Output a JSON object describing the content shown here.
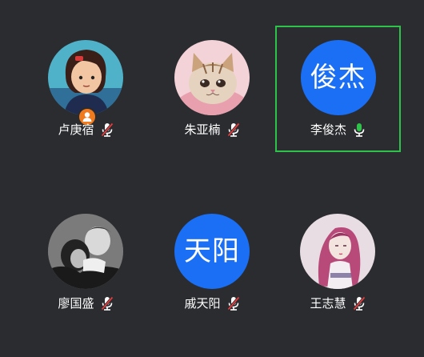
{
  "participants": [
    {
      "name": "卢庚宿",
      "avatar": "anime-girl-photo",
      "mic": "muted",
      "host": true
    },
    {
      "name": "朱亚楠",
      "avatar": "kitten-photo",
      "mic": "muted",
      "host": false
    },
    {
      "name": "李俊杰",
      "avatar_text": "俊杰",
      "mic": "active",
      "host": false
    },
    {
      "name": "廖国盛",
      "avatar": "couple-photo",
      "mic": "muted",
      "host": false
    },
    {
      "name": "戚天阳",
      "avatar_text": "天阳",
      "mic": "muted",
      "host": false
    },
    {
      "name": "王志慧",
      "avatar": "illustrated-girl-photo",
      "mic": "muted",
      "host": false
    }
  ],
  "colors": {
    "background": "#2b2c30",
    "active_speaker_border": "#2ec24a",
    "text_avatar_bg": "#1a6ff5",
    "mic_muted_slash": "#e43b3b",
    "mic_active": "#2ec24a",
    "host_badge": "#f07a1e"
  }
}
